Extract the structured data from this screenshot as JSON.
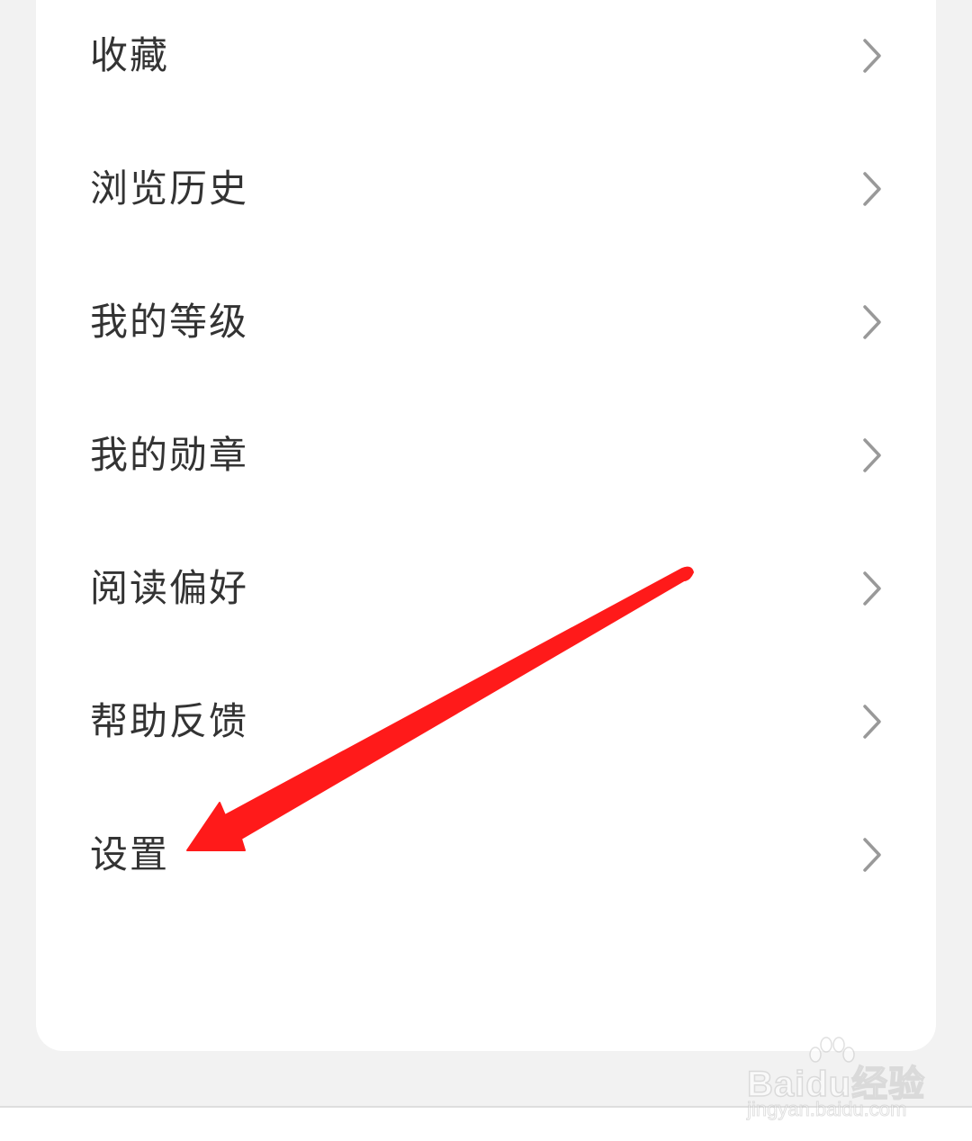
{
  "menu": {
    "items": [
      {
        "label": "收藏",
        "icon": "chevron-right-icon"
      },
      {
        "label": "浏览历史",
        "icon": "chevron-right-icon"
      },
      {
        "label": "我的等级",
        "icon": "chevron-right-icon"
      },
      {
        "label": "我的勋章",
        "icon": "chevron-right-icon"
      },
      {
        "label": "阅读偏好",
        "icon": "chevron-right-icon"
      },
      {
        "label": "帮助反馈",
        "icon": "chevron-right-icon"
      },
      {
        "label": "设置",
        "icon": "chevron-right-icon"
      }
    ]
  },
  "annotation": {
    "icon": "red-arrow-icon",
    "color": "#ff1a1a"
  },
  "watermark": {
    "logo": "Baidu经验",
    "url": "jingyan.baidu.com"
  },
  "colors": {
    "background": "#f2f2f2",
    "card": "#ffffff",
    "text": "#333333",
    "chevron": "#999999"
  }
}
